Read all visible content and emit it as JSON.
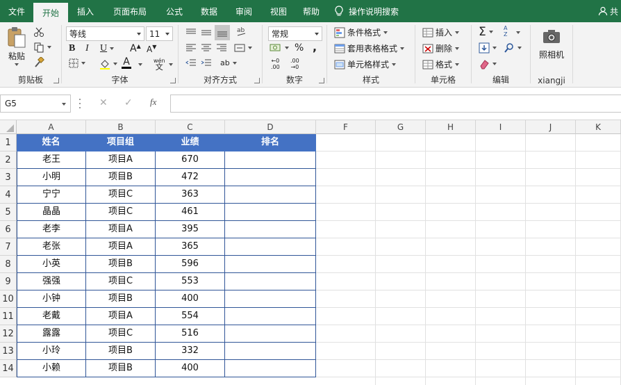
{
  "menu": {
    "tabs": [
      "文件",
      "开始",
      "插入",
      "页面布局",
      "公式",
      "数据",
      "审阅",
      "视图",
      "帮助"
    ],
    "active_index": 1,
    "tell_me": "操作说明搜索",
    "user_initial": "共"
  },
  "ribbon": {
    "clipboard": {
      "paste": "粘贴",
      "label": "剪贴板"
    },
    "font": {
      "name": "等线",
      "size": "11",
      "bold": "B",
      "italic": "I",
      "underline": "U",
      "grow": "A",
      "shrink": "A",
      "phonetic_top": "wén",
      "phonetic_bottom": "文",
      "font_color_letter": "A",
      "label": "字体"
    },
    "alignment": {
      "label": "对齐方式",
      "wrap": "ab"
    },
    "number": {
      "format": "常规",
      "percent": "%",
      "comma": ",",
      "inc_top": "←0",
      "inc_bottom": ".00",
      "dec_top": ".00",
      "dec_bottom": "→0",
      "label": "数字"
    },
    "styles": {
      "conditional": "条件格式",
      "table": "套用表格格式",
      "cell_styles": "单元格样式",
      "label": "样式"
    },
    "cells": {
      "insert": "插入",
      "delete": "删除",
      "format": "格式",
      "label": "单元格"
    },
    "editing": {
      "sum": "Σ",
      "sort": "A",
      "sort_bottom": "Z",
      "label": "编辑"
    },
    "camera": {
      "name": "照相机",
      "label": "xiangji"
    }
  },
  "formula_bar": {
    "name_box": "G5",
    "cancel": "✕",
    "enter": "✓",
    "fx": "fx",
    "content": ""
  },
  "sheet": {
    "column_headers": [
      "A",
      "B",
      "C",
      "D",
      "F",
      "G",
      "H",
      "I",
      "J",
      "K"
    ],
    "row_numbers": [
      "1",
      "2",
      "3",
      "4",
      "5",
      "6",
      "7",
      "8",
      "9",
      "10",
      "11",
      "12",
      "13",
      "14"
    ],
    "table_headers": [
      "姓名",
      "项目组",
      "业绩",
      "排名"
    ],
    "rows": [
      [
        "老王",
        "项目A",
        "670",
        ""
      ],
      [
        "小明",
        "项目B",
        "472",
        ""
      ],
      [
        "宁宁",
        "项目C",
        "363",
        ""
      ],
      [
        "晶晶",
        "项目C",
        "461",
        ""
      ],
      [
        "老李",
        "项目A",
        "395",
        ""
      ],
      [
        "老张",
        "项目A",
        "365",
        ""
      ],
      [
        "小英",
        "项目B",
        "596",
        ""
      ],
      [
        "强强",
        "项目C",
        "553",
        ""
      ],
      [
        "小钟",
        "项目B",
        "400",
        ""
      ],
      [
        "老戴",
        "项目A",
        "554",
        ""
      ],
      [
        "露露",
        "项目C",
        "516",
        ""
      ],
      [
        "小玲",
        "项目B",
        "332",
        ""
      ],
      [
        "小赖",
        "项目B",
        "400",
        ""
      ]
    ]
  },
  "colors": {
    "brand": "#217346",
    "header_fill": "#4472c4",
    "border": "#2f5597"
  }
}
